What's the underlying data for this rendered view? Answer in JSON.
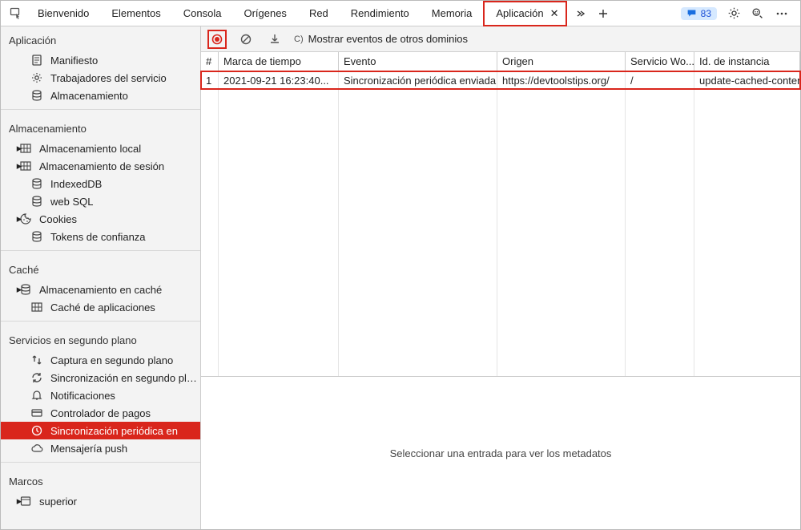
{
  "tabs": {
    "items": [
      {
        "label": "Bienvenido"
      },
      {
        "label": "Elementos"
      },
      {
        "label": "Consola"
      },
      {
        "label": "Orígenes"
      },
      {
        "label": "Red"
      },
      {
        "label": "Rendimiento"
      },
      {
        "label": "Memoria"
      },
      {
        "label": "Aplicación",
        "active": true
      }
    ]
  },
  "issue_count": "83",
  "toolbar": {
    "show_other_label": "Mostrar eventos de otros dominios",
    "show_other_hint": "C)"
  },
  "sidebar": {
    "app": {
      "title": "Aplicación",
      "items": [
        {
          "icon": "manifest",
          "label": "Manifiesto"
        },
        {
          "icon": "gear",
          "label": "Trabajadores del servicio"
        },
        {
          "icon": "db",
          "label": "Almacenamiento"
        }
      ]
    },
    "storage": {
      "title": "Almacenamiento",
      "items": [
        {
          "icon": "grid",
          "label": "Almacenamiento local",
          "expand": true
        },
        {
          "icon": "grid",
          "label": "Almacenamiento de sesión",
          "expand": true
        },
        {
          "icon": "db",
          "label": "IndexedDB"
        },
        {
          "icon": "db",
          "label": "web SQL"
        },
        {
          "icon": "cookie",
          "label": "Cookies",
          "expand": true
        },
        {
          "icon": "db",
          "label": "Tokens de confianza"
        }
      ]
    },
    "cache": {
      "title": "Caché",
      "items": [
        {
          "icon": "db",
          "label": "Almacenamiento en caché",
          "expand": true
        },
        {
          "icon": "grid",
          "label": "Caché de aplicaciones"
        }
      ]
    },
    "bg": {
      "title": "Servicios en segundo plano",
      "items": [
        {
          "icon": "fetch",
          "label": "Captura en segundo plano"
        },
        {
          "icon": "sync",
          "label": "Sincronización en segundo plano"
        },
        {
          "icon": "bell",
          "label": "Notificaciones"
        },
        {
          "icon": "card",
          "label": "Controlador de pagos"
        },
        {
          "icon": "clock",
          "label": "Sincronización periódica en",
          "selected": true
        },
        {
          "icon": "cloud",
          "label": "Mensajería push"
        }
      ]
    },
    "frames": {
      "title": "Marcos",
      "items": [
        {
          "icon": "window",
          "label": "superior",
          "expand": true
        }
      ]
    }
  },
  "table": {
    "headers": {
      "idx": "#",
      "timestamp": "Marca de tiempo",
      "event": "Evento",
      "origin": "Origen",
      "sw": "Servicio Wo...",
      "instance": "Id. de instancia"
    },
    "rows": [
      {
        "idx": "1",
        "timestamp": "2021-09-21 16:23:40...",
        "event": "Sincronización periódica enviada",
        "origin": "https://devtoolstips.org/",
        "sw": "/",
        "instance": "update-cached-content"
      }
    ]
  },
  "detail_placeholder": "Seleccionar una entrada para ver los metadatos"
}
